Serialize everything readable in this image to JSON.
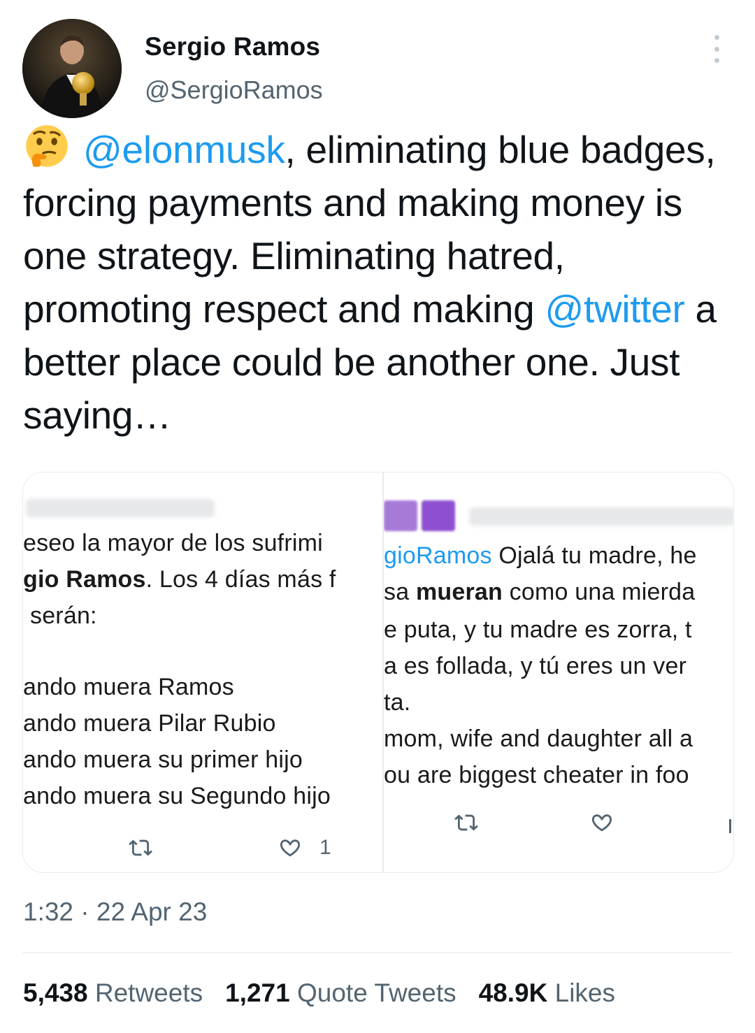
{
  "author": {
    "name": "Sergio Ramos",
    "handle": "@SergioRamos"
  },
  "tweet": {
    "emoji": "thinking-face-emoji",
    "mention1": "@elonmusk",
    "text_part1": ", eliminating blue badges, forcing payments and making money is one strategy. Eliminating hatred, promoting respect and making ",
    "mention2": "@twitter",
    "text_part2": " a better place could be another one. Just saying…"
  },
  "media": {
    "left": {
      "lines": [
        "eseo la mayor de los sufrimi",
        "gio Ramos",
        ". Los 4 días más f",
        "serán:",
        "ando muera Ramos",
        "ando muera Pilar Rubio",
        "ando muera su primer hijo",
        "ando muera su Segundo hijo"
      ],
      "like_count": "1"
    },
    "right": {
      "mention": "gioRamos",
      "lines": [
        " Ojalá tu madre, he",
        "sa ",
        "mueran",
        " como una mierda",
        "e puta, y tu madre es zorra, t",
        "a es follada, y tú eres un ver",
        "ta.",
        "mom, wife and daughter all a",
        "ou are biggest cheater in foo"
      ]
    }
  },
  "timestamp": "1:32 · 22 Apr 23",
  "stats": {
    "retweets_count": "5,438",
    "retweets_label": "Retweets",
    "quotes_count": "1,271",
    "quotes_label": "Quote Tweets",
    "likes_count": "48.9K",
    "likes_label": "Likes"
  },
  "colors": {
    "accent": "#1d9bf0",
    "secondary_text": "#536471",
    "primary_text": "#0f1419"
  }
}
